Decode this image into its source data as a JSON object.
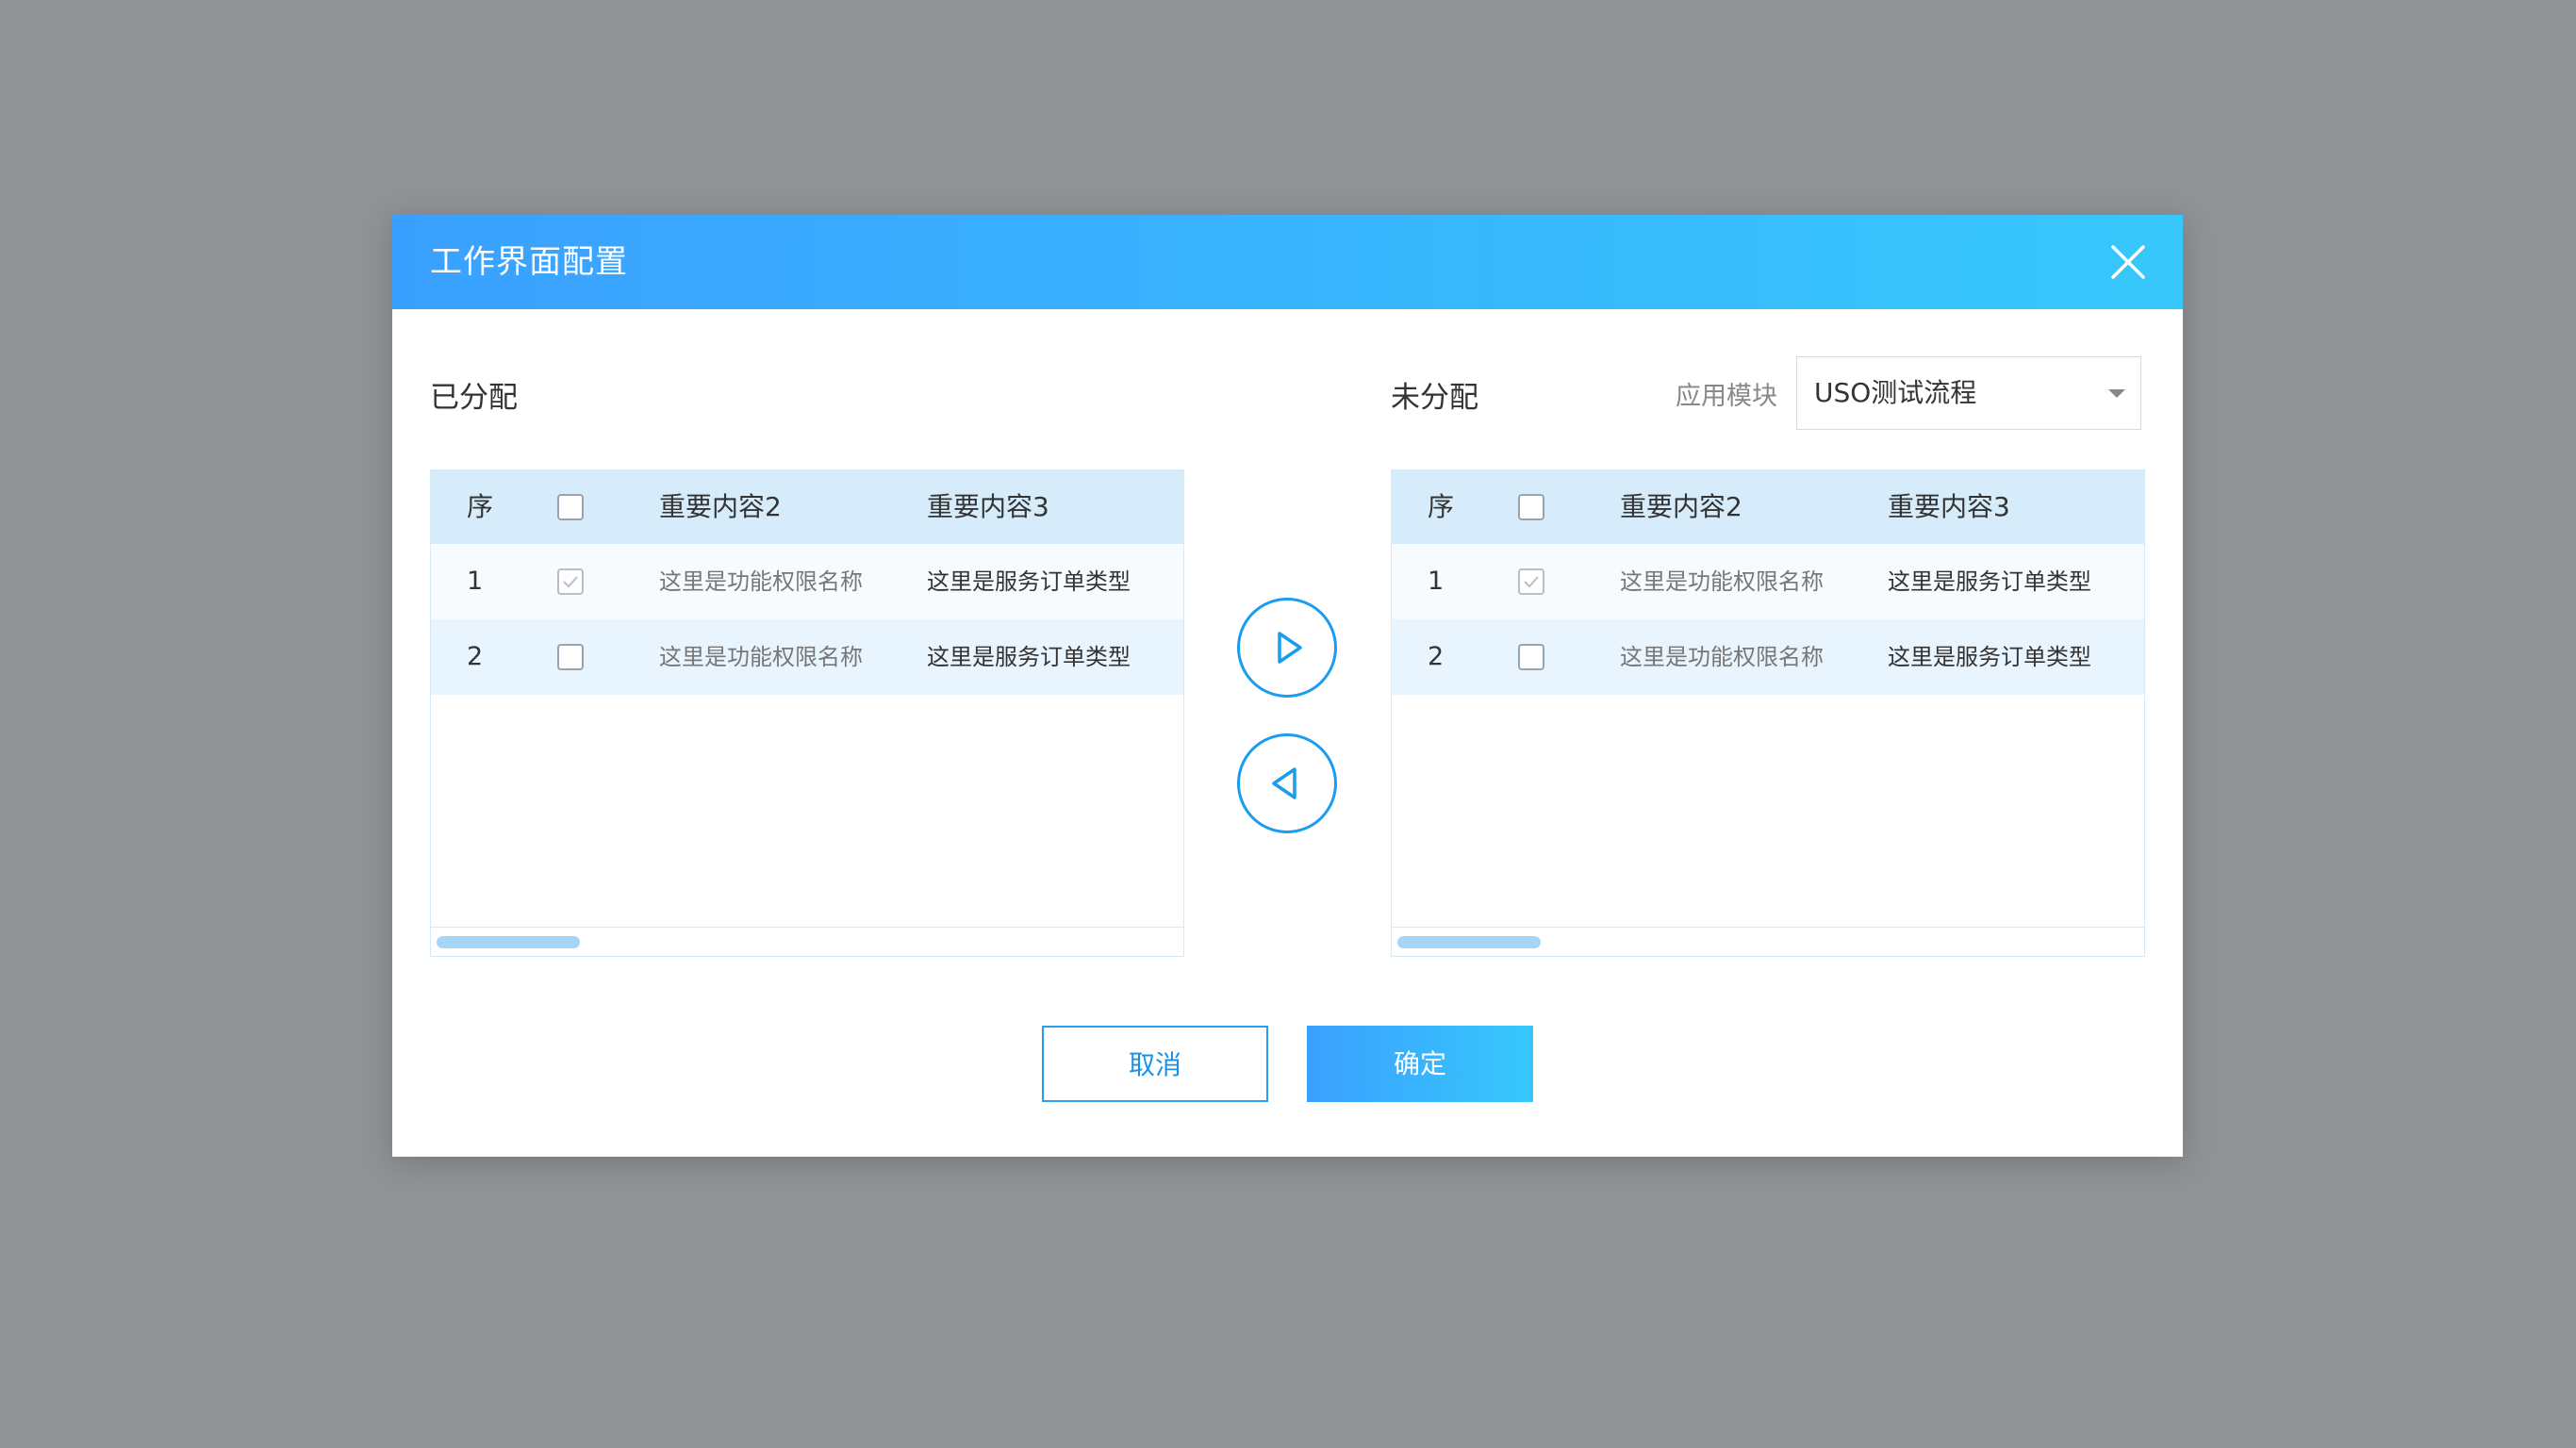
{
  "dialog": {
    "title": "工作界面配置",
    "cancel_label": "取消",
    "confirm_label": "确定"
  },
  "module": {
    "label": "应用模块",
    "selected": "USO测试流程"
  },
  "assigned": {
    "title": "已分配",
    "columns": [
      "序",
      "重要内容2",
      "重要内容3"
    ],
    "rows": [
      {
        "idx": "1",
        "checked": true,
        "c2": "这里是功能权限名称",
        "c3": "这里是服务订单类型"
      },
      {
        "idx": "2",
        "checked": false,
        "c2": "这里是功能权限名称",
        "c3": "这里是服务订单类型"
      }
    ]
  },
  "unassigned": {
    "title": "未分配",
    "columns": [
      "序",
      "重要内容2",
      "重要内容3"
    ],
    "rows": [
      {
        "idx": "1",
        "checked": true,
        "c2": "这里是功能权限名称",
        "c3": "这里是服务订单类型"
      },
      {
        "idx": "2",
        "checked": false,
        "c2": "这里是功能权限名称",
        "c3": "这里是服务订单类型"
      }
    ]
  },
  "colors": {
    "accent": "#1a9cef",
    "header_gradient_start": "#3aa0ff",
    "header_gradient_end": "#37c8fb",
    "overlay": "#8f9396"
  },
  "icons": {
    "close": "close-icon",
    "move_right": "triangle-right-icon",
    "move_left": "triangle-left-icon",
    "dropdown": "caret-down-icon",
    "check": "check-icon"
  }
}
